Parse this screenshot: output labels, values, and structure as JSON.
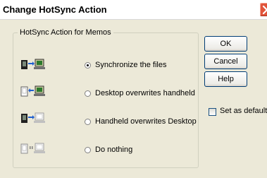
{
  "dialog": {
    "title": "Change HotSync Action",
    "group_label": "HotSync Action for Memos",
    "options": [
      {
        "label": "Synchronize the files",
        "selected": true,
        "icon": "sync-both-icon"
      },
      {
        "label": "Desktop overwrites handheld",
        "selected": false,
        "icon": "desktop-to-handheld-icon"
      },
      {
        "label": "Handheld overwrites Desktop",
        "selected": false,
        "icon": "handheld-to-desktop-icon"
      },
      {
        "label": "Do nothing",
        "selected": false,
        "icon": "do-nothing-icon"
      }
    ],
    "buttons": {
      "ok": "OK",
      "cancel": "Cancel",
      "help": "Help"
    },
    "set_default_label": "Set as default",
    "set_default_checked": false
  }
}
